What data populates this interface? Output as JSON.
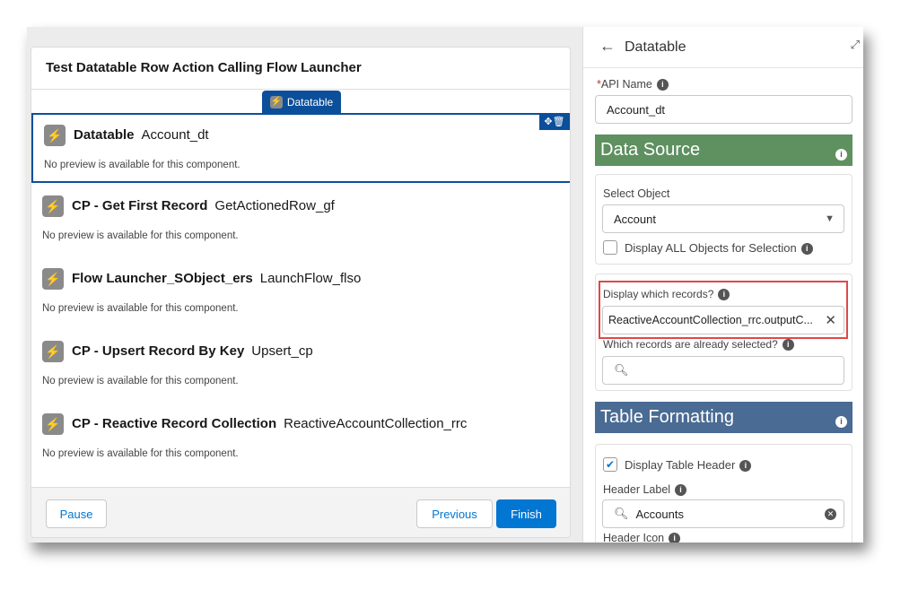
{
  "screen": {
    "title": "Test Datatable Row Action Calling Flow Launcher",
    "active_tab": "Datatable",
    "components": [
      {
        "type": "Datatable",
        "name": "Account_dt",
        "note": "No preview is available for this component."
      },
      {
        "type": "CP - Get First Record",
        "name": "GetActionedRow_gf",
        "note": "No preview is available for this component."
      },
      {
        "type": "Flow Launcher_SObject_ers",
        "name": "LaunchFlow_flso",
        "note": "No preview is available for this component."
      },
      {
        "type": "CP - Upsert Record By Key",
        "name": "Upsert_cp",
        "note": "No preview is available for this component."
      },
      {
        "type": "CP - Reactive Record Collection",
        "name": "ReactiveAccountCollection_rrc",
        "note": "No preview is available for this component."
      }
    ],
    "footer": {
      "pause": "Pause",
      "previous": "Previous",
      "finish": "Finish"
    }
  },
  "panel": {
    "title": "Datatable",
    "api_name_label": "API Name",
    "api_name_value": "Account_dt",
    "data_source": {
      "heading": "Data Source",
      "color": "#5e9060",
      "select_object_label": "Select Object",
      "select_object_value": "Account",
      "display_all_label": "Display ALL Objects for Selection",
      "display_all_checked": false,
      "records_label": "Display which records?",
      "records_value": "ReactiveAccountCollection_rrc.outputC...",
      "selected_label": "Which records are already selected?",
      "selected_value": ""
    },
    "table_formatting": {
      "heading": "Table Formatting",
      "color": "#4a6b93",
      "display_header_label": "Display Table Header",
      "display_header_checked": true,
      "header_label_label": "Header Label",
      "header_label_value": "Accounts",
      "header_icon_label": "Header Icon"
    }
  }
}
